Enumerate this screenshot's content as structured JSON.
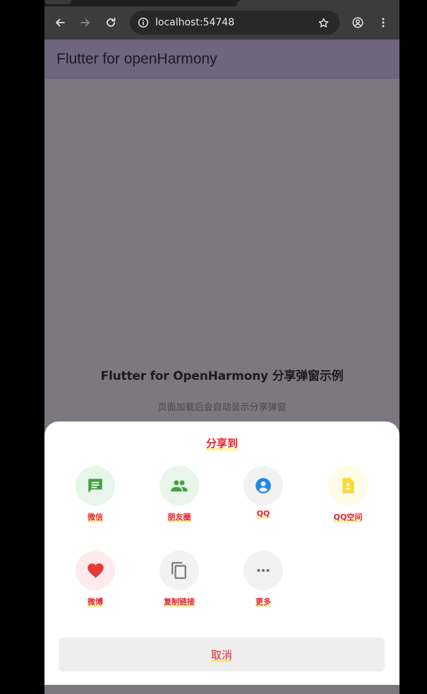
{
  "browser": {
    "url": "localhost:54748"
  },
  "app": {
    "title": "Flutter for openHarmony"
  },
  "page": {
    "heading": "Flutter for OpenHarmony 分享弹窗示例",
    "subheading": "页面加载后会自动显示分享弹窗"
  },
  "share_sheet": {
    "title": "分享到",
    "items": [
      {
        "label": "微信",
        "icon": "chat-icon",
        "color": "#43a047",
        "bg": "#e8f5e9"
      },
      {
        "label": "朋友圈",
        "icon": "people-icon",
        "color": "#43a047",
        "bg": "#e8f5e9"
      },
      {
        "label": "QQ",
        "icon": "account-circle-icon",
        "color": "#1e88e5",
        "bg": "#f2f2f2"
      },
      {
        "label": "QQ空间",
        "icon": "contact-page-icon",
        "color": "#fdd835",
        "bg": "#fffde7"
      },
      {
        "label": "微博",
        "icon": "heart-icon",
        "color": "#e53935",
        "bg": "#ffebee"
      },
      {
        "label": "复制链接",
        "icon": "copy-icon",
        "color": "#757575",
        "bg": "#f2f2f2"
      },
      {
        "label": "更多",
        "icon": "more-horiz-icon",
        "color": "#757575",
        "bg": "#f2f2f2"
      }
    ],
    "cancel_label": "取消"
  },
  "colors": {
    "accent_text": "#e8202a",
    "appbar": "#6f657f",
    "scrim": "#7d7880"
  }
}
